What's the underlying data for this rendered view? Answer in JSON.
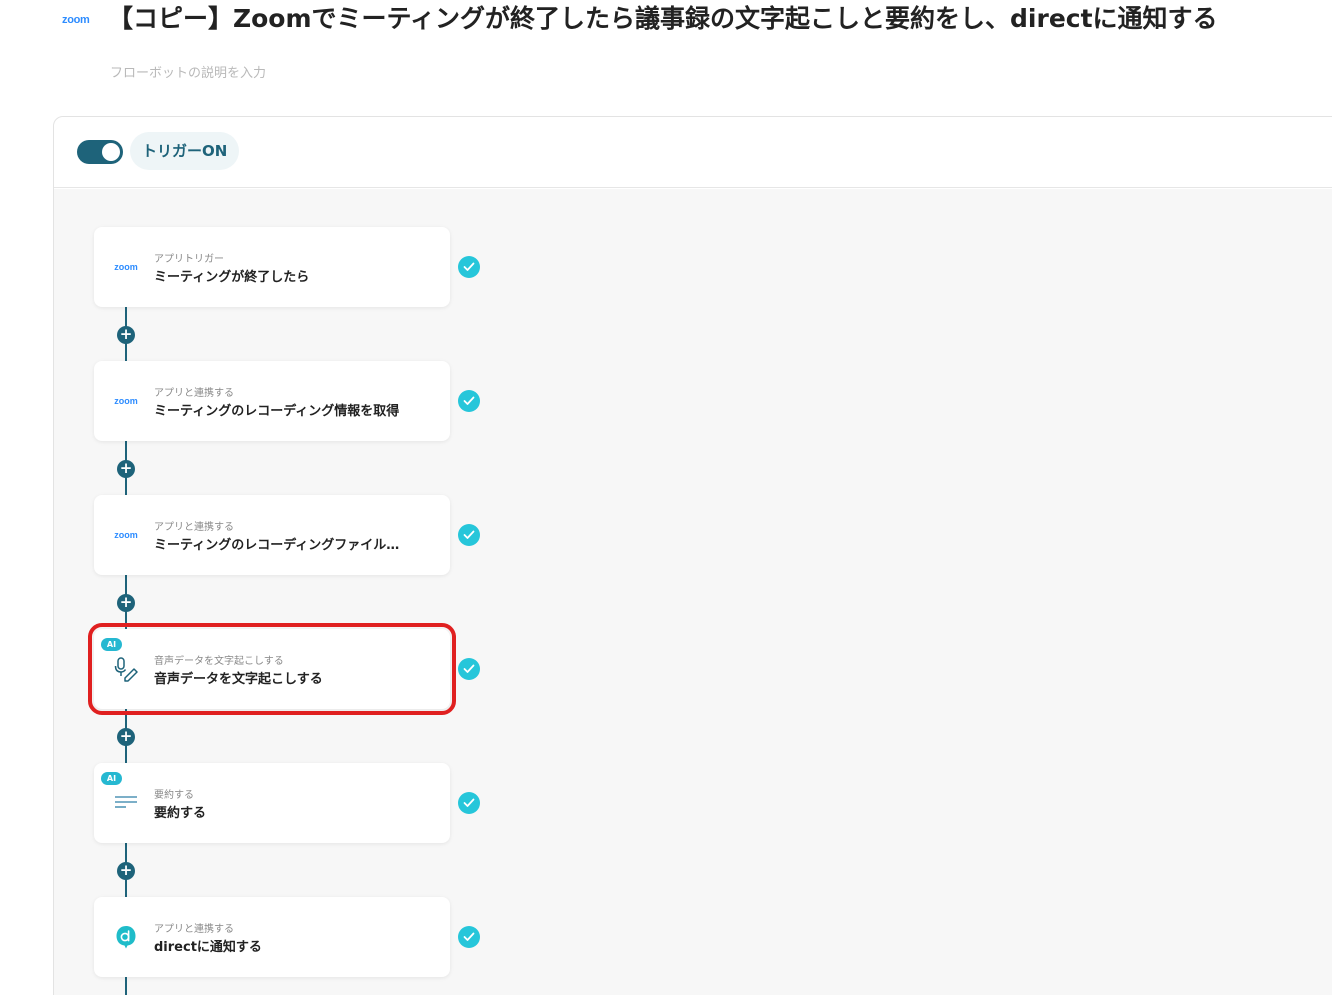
{
  "header": {
    "logo": "zoom",
    "title": "【コピー】Zoomでミーティングが終了したら議事録の文字起こしと要約をし、directに通知する",
    "description_placeholder": "フローボットの説明を入力"
  },
  "trigger": {
    "label": "トリガーON",
    "state": "on"
  },
  "steps": [
    {
      "subtitle": "アプリトリガー",
      "title": "ミーティングが終了したら",
      "logo": "zoom"
    },
    {
      "subtitle": "アプリと連携する",
      "title": "ミーティングのレコーディング情報を取得",
      "logo": "zoom"
    },
    {
      "subtitle": "アプリと連携する",
      "title": "ミーティングのレコーディングファイル…",
      "logo": "zoom"
    },
    {
      "subtitle": "音声データを文字起こしする",
      "title": "音声データを文字起こしする",
      "ai": "AI"
    },
    {
      "subtitle": "要約する",
      "title": "要約する",
      "ai": "AI"
    },
    {
      "subtitle": "アプリと連携する",
      "title": "directに通知する"
    }
  ],
  "colors": {
    "accent": "#1e637a",
    "check": "#26c6da",
    "highlight": "#e02020",
    "zoom": "#2d8cff"
  }
}
